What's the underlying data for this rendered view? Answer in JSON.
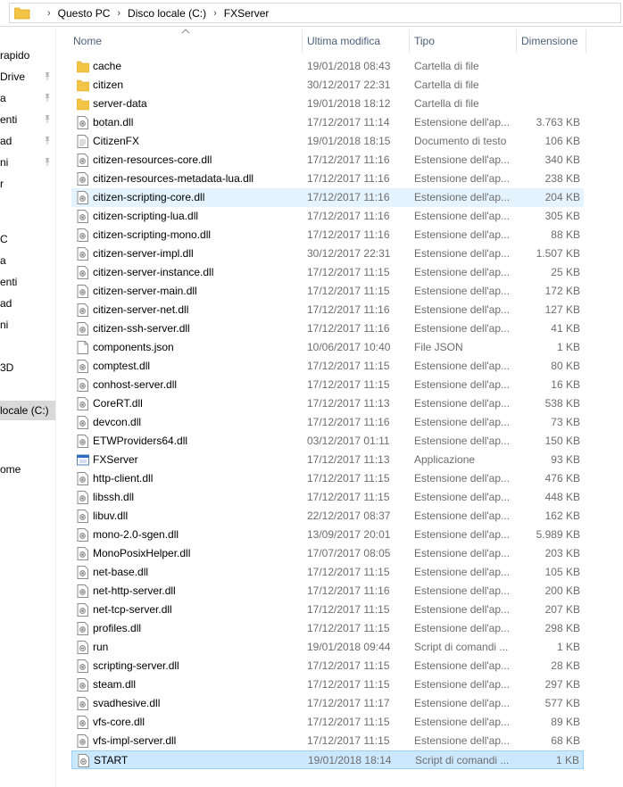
{
  "breadcrumb": [
    "Questo PC",
    "Disco locale (C:)",
    "FXServer"
  ],
  "columns": {
    "name": "Nome",
    "modified": "Ultima modifica",
    "type": "Tipo",
    "size": "Dimensione"
  },
  "nav": [
    {
      "label": "rapido",
      "pinned": false,
      "selected": false
    },
    {
      "label": "Drive",
      "pinned": true,
      "selected": false
    },
    {
      "label": "a",
      "pinned": true,
      "selected": false
    },
    {
      "label": "enti",
      "pinned": true,
      "selected": false
    },
    {
      "label": "ad",
      "pinned": true,
      "selected": false
    },
    {
      "label": "ni",
      "pinned": true,
      "selected": false
    },
    {
      "label": "r",
      "pinned": false,
      "selected": false
    },
    {
      "label": "",
      "pinned": false,
      "selected": false
    },
    {
      "label": "C",
      "pinned": false,
      "selected": false
    },
    {
      "label": "a",
      "pinned": false,
      "selected": false
    },
    {
      "label": "enti",
      "pinned": false,
      "selected": false
    },
    {
      "label": "ad",
      "pinned": false,
      "selected": false
    },
    {
      "label": "ni",
      "pinned": false,
      "selected": false
    },
    {
      "label": "",
      "pinned": false,
      "selected": false
    },
    {
      "label": "3D",
      "pinned": false,
      "selected": false
    },
    {
      "label": "",
      "pinned": false,
      "selected": false
    },
    {
      "label": "locale (C:)",
      "pinned": false,
      "selected": true
    },
    {
      "label": "",
      "pinned": false,
      "selected": false
    },
    {
      "label": "",
      "pinned": false,
      "selected": false
    },
    {
      "label": "ome",
      "pinned": false,
      "selected": false
    }
  ],
  "files": [
    {
      "name": "cache",
      "date": "19/01/2018 08:43",
      "type": "Cartella di file",
      "size": "",
      "icon": "folder"
    },
    {
      "name": "citizen",
      "date": "30/12/2017 22:31",
      "type": "Cartella di file",
      "size": "",
      "icon": "folder"
    },
    {
      "name": "server-data",
      "date": "19/01/2018 18:12",
      "type": "Cartella di file",
      "size": "",
      "icon": "folder"
    },
    {
      "name": "botan.dll",
      "date": "17/12/2017 11:14",
      "type": "Estensione dell'ap...",
      "size": "3.763 KB",
      "icon": "dll"
    },
    {
      "name": "CitizenFX",
      "date": "19/01/2018 18:15",
      "type": "Documento di testo",
      "size": "106 KB",
      "icon": "text"
    },
    {
      "name": "citizen-resources-core.dll",
      "date": "17/12/2017 11:16",
      "type": "Estensione dell'ap...",
      "size": "340 KB",
      "icon": "dll"
    },
    {
      "name": "citizen-resources-metadata-lua.dll",
      "date": "17/12/2017 11:16",
      "type": "Estensione dell'ap...",
      "size": "238 KB",
      "icon": "dll"
    },
    {
      "name": "citizen-scripting-core.dll",
      "date": "17/12/2017 11:16",
      "type": "Estensione dell'ap...",
      "size": "204 KB",
      "icon": "dll",
      "state": "hover"
    },
    {
      "name": "citizen-scripting-lua.dll",
      "date": "17/12/2017 11:16",
      "type": "Estensione dell'ap...",
      "size": "305 KB",
      "icon": "dll"
    },
    {
      "name": "citizen-scripting-mono.dll",
      "date": "17/12/2017 11:16",
      "type": "Estensione dell'ap...",
      "size": "88 KB",
      "icon": "dll"
    },
    {
      "name": "citizen-server-impl.dll",
      "date": "30/12/2017 22:31",
      "type": "Estensione dell'ap...",
      "size": "1.507 KB",
      "icon": "dll"
    },
    {
      "name": "citizen-server-instance.dll",
      "date": "17/12/2017 11:15",
      "type": "Estensione dell'ap...",
      "size": "25 KB",
      "icon": "dll"
    },
    {
      "name": "citizen-server-main.dll",
      "date": "17/12/2017 11:15",
      "type": "Estensione dell'ap...",
      "size": "172 KB",
      "icon": "dll"
    },
    {
      "name": "citizen-server-net.dll",
      "date": "17/12/2017 11:16",
      "type": "Estensione dell'ap...",
      "size": "127 KB",
      "icon": "dll"
    },
    {
      "name": "citizen-ssh-server.dll",
      "date": "17/12/2017 11:16",
      "type": "Estensione dell'ap...",
      "size": "41 KB",
      "icon": "dll"
    },
    {
      "name": "components.json",
      "date": "10/06/2017 10:40",
      "type": "File JSON",
      "size": "1 KB",
      "icon": "file"
    },
    {
      "name": "comptest.dll",
      "date": "17/12/2017 11:15",
      "type": "Estensione dell'ap...",
      "size": "80 KB",
      "icon": "dll"
    },
    {
      "name": "conhost-server.dll",
      "date": "17/12/2017 11:15",
      "type": "Estensione dell'ap...",
      "size": "16 KB",
      "icon": "dll"
    },
    {
      "name": "CoreRT.dll",
      "date": "17/12/2017 11:13",
      "type": "Estensione dell'ap...",
      "size": "538 KB",
      "icon": "dll"
    },
    {
      "name": "devcon.dll",
      "date": "17/12/2017 11:16",
      "type": "Estensione dell'ap...",
      "size": "73 KB",
      "icon": "dll"
    },
    {
      "name": "ETWProviders64.dll",
      "date": "03/12/2017 01:11",
      "type": "Estensione dell'ap...",
      "size": "150 KB",
      "icon": "dll"
    },
    {
      "name": "FXServer",
      "date": "17/12/2017 11:13",
      "type": "Applicazione",
      "size": "93 KB",
      "icon": "app"
    },
    {
      "name": "http-client.dll",
      "date": "17/12/2017 11:15",
      "type": "Estensione dell'ap...",
      "size": "476 KB",
      "icon": "dll"
    },
    {
      "name": "libssh.dll",
      "date": "17/12/2017 11:15",
      "type": "Estensione dell'ap...",
      "size": "448 KB",
      "icon": "dll"
    },
    {
      "name": "libuv.dll",
      "date": "22/12/2017 08:37",
      "type": "Estensione dell'ap...",
      "size": "162 KB",
      "icon": "dll"
    },
    {
      "name": "mono-2.0-sgen.dll",
      "date": "13/09/2017 20:01",
      "type": "Estensione dell'ap...",
      "size": "5.989 KB",
      "icon": "dll"
    },
    {
      "name": "MonoPosixHelper.dll",
      "date": "17/07/2017 08:05",
      "type": "Estensione dell'ap...",
      "size": "203 KB",
      "icon": "dll"
    },
    {
      "name": "net-base.dll",
      "date": "17/12/2017 11:15",
      "type": "Estensione dell'ap...",
      "size": "105 KB",
      "icon": "dll"
    },
    {
      "name": "net-http-server.dll",
      "date": "17/12/2017 11:16",
      "type": "Estensione dell'ap...",
      "size": "200 KB",
      "icon": "dll"
    },
    {
      "name": "net-tcp-server.dll",
      "date": "17/12/2017 11:15",
      "type": "Estensione dell'ap...",
      "size": "207 KB",
      "icon": "dll"
    },
    {
      "name": "profiles.dll",
      "date": "17/12/2017 11:15",
      "type": "Estensione dell'ap...",
      "size": "298 KB",
      "icon": "dll"
    },
    {
      "name": "run",
      "date": "19/01/2018 09:44",
      "type": "Script di comandi ...",
      "size": "1 KB",
      "icon": "script"
    },
    {
      "name": "scripting-server.dll",
      "date": "17/12/2017 11:15",
      "type": "Estensione dell'ap...",
      "size": "28 KB",
      "icon": "dll"
    },
    {
      "name": "steam.dll",
      "date": "17/12/2017 11:15",
      "type": "Estensione dell'ap...",
      "size": "297 KB",
      "icon": "dll"
    },
    {
      "name": "svadhesive.dll",
      "date": "17/12/2017 11:17",
      "type": "Estensione dell'ap...",
      "size": "577 KB",
      "icon": "dll"
    },
    {
      "name": "vfs-core.dll",
      "date": "17/12/2017 11:15",
      "type": "Estensione dell'ap...",
      "size": "89 KB",
      "icon": "dll"
    },
    {
      "name": "vfs-impl-server.dll",
      "date": "17/12/2017 11:15",
      "type": "Estensione dell'ap...",
      "size": "68 KB",
      "icon": "dll"
    },
    {
      "name": "START",
      "date": "19/01/2018 18:14",
      "type": "Script di comandi ...",
      "size": "1 KB",
      "icon": "script",
      "state": "selected"
    }
  ],
  "colors": {
    "folder": "#f3c546",
    "header_text": "#4c607a",
    "hover": "#e5f3ff",
    "selected": "#cce8ff",
    "selected_border": "#99d1ff"
  }
}
